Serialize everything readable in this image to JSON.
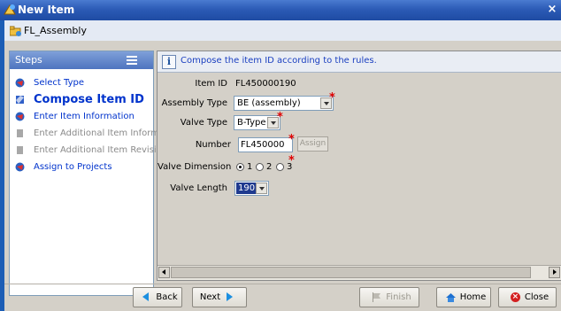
{
  "window": {
    "title": "New Item",
    "close_glyph": "×"
  },
  "breadcrumb": {
    "item": "FL_Assembly"
  },
  "steps": {
    "header": "Steps",
    "items": [
      {
        "label": "Select Type",
        "state": "done",
        "icon": "step-done-icon"
      },
      {
        "label": "Compose Item ID",
        "state": "current",
        "icon": "step-current-icon"
      },
      {
        "label": "Enter Item Information",
        "state": "todo",
        "icon": "step-todo-icon"
      },
      {
        "label": "Enter Additional Item Inform",
        "state": "disabled",
        "icon": "step-disabled-icon"
      },
      {
        "label": "Enter Additional Item Revisic",
        "state": "disabled",
        "icon": "step-disabled-icon"
      },
      {
        "label": "Assign to Projects",
        "state": "todo",
        "icon": "step-todo-icon"
      }
    ]
  },
  "info": {
    "message": "Compose the item ID according to the rules."
  },
  "form": {
    "item_id": {
      "label": "Item ID",
      "value": "FL450000190"
    },
    "assembly_type": {
      "label": "Assembly Type",
      "value": "BE (assembly)"
    },
    "valve_type": {
      "label": "Valve Type",
      "value": "B-Type"
    },
    "number": {
      "label": "Number",
      "value": "FL450000",
      "assign_label": "Assign"
    },
    "valve_dimension": {
      "label": "Valve Dimension",
      "options": [
        "1",
        "2",
        "3"
      ],
      "selected": "1"
    },
    "valve_length": {
      "label": "Valve Length",
      "value": "190"
    },
    "required_marker": "*"
  },
  "buttons": {
    "back": "Back",
    "next": "Next",
    "finish": "Finish",
    "home": "Home",
    "close": "Close"
  },
  "colors": {
    "titlebar": "#2c5bb6",
    "link": "#0033cc",
    "info_text": "#1a3fc0",
    "required": "#e00000"
  }
}
